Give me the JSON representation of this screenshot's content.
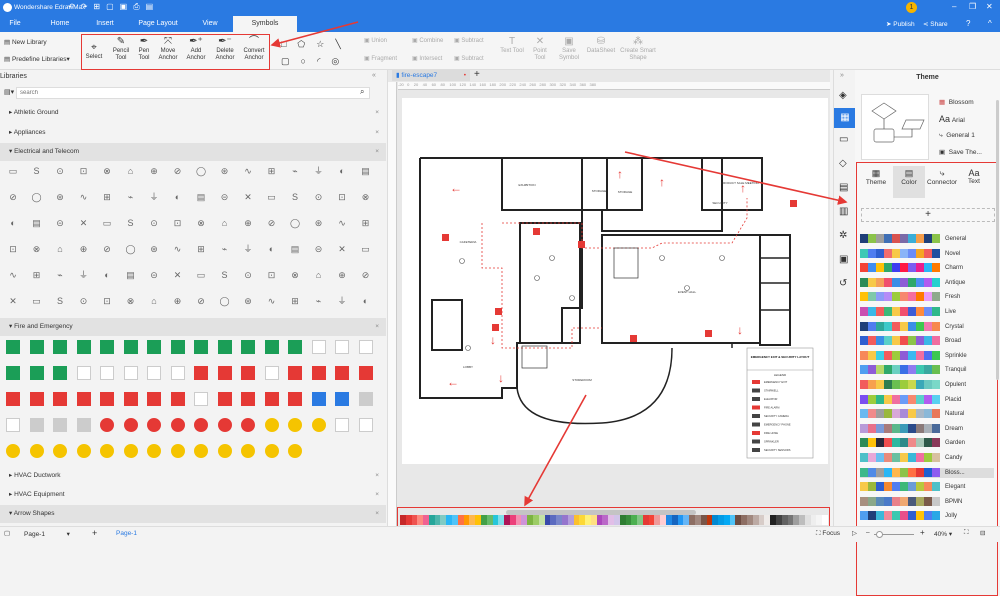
{
  "app": {
    "title": "Wondershare EdrawMax",
    "user_badge": "1",
    "publish": "Publish",
    "share": "Share"
  },
  "tabs": [
    "File",
    "Home",
    "Insert",
    "Page Layout",
    "View",
    "Symbols"
  ],
  "toolbar": {
    "new_library": "New Library",
    "predefine": "Predefine Libraries",
    "tools": [
      "Select",
      "Pencil Tool",
      "Pen Tool",
      "Move Anchor",
      "Add Anchor",
      "Delete Anchor",
      "Convert Anchor"
    ],
    "shape_ops": [
      "Union",
      "Combine",
      "Subtract",
      "Fragment",
      "Intersect",
      "Subtract"
    ],
    "more": [
      "Text Tool",
      "Point Tool",
      "Save Symbol",
      "DataSheet",
      "Create Smart Shape"
    ]
  },
  "libraries": {
    "title": "Libraries",
    "search_placeholder": "search",
    "categories": [
      "Athletic Ground",
      "Appliances",
      "Electrical and Telecom",
      "Fire and Emergency",
      "HVAC Ductwork",
      "HVAC Equipment",
      "Arrow Shapes"
    ]
  },
  "document": {
    "tab": "fire-escape7",
    "rooms": [
      "EXHIBITION",
      "STORAGE",
      "STORAGE",
      "SECURITY",
      "PRODUCT SALE MEETING",
      "CAFETERIA",
      "EVENT HALL",
      "LOBBY",
      "STOREROOM"
    ],
    "legend_title": "EMERGENCY EXIT & SECURITY LAYOUT",
    "legend_heading": "LEGEND",
    "legend_items": [
      "EMERGENCY EXIT",
      "STAIRWELL",
      "ELEVATOR",
      "FIRE ALARM",
      "SECURITY CAMERA",
      "EMERGENCY PHONE",
      "FIRE HOSE",
      "SPRINKLER",
      "SECURITY SENSORS"
    ]
  },
  "theme_panel": {
    "title": "Theme",
    "current": [
      "Blossom",
      "Arial",
      "General 1",
      "Save The..."
    ],
    "tabs": [
      "Theme",
      "Color",
      "Connector",
      "Text"
    ],
    "palettes": [
      {
        "name": "General",
        "colors": [
          "#1f3f78",
          "#8bc34a",
          "#9e9e9e",
          "#3f6fb5",
          "#d9534f",
          "#7a6aa8",
          "#3aaed8",
          "#f59d4a",
          "#1f3f78",
          "#8bc34a"
        ]
      },
      {
        "name": "Novel",
        "colors": [
          "#3ec9b5",
          "#4f7df0",
          "#2f5fd0",
          "#f06e6e",
          "#f7c948",
          "#8ab4f8",
          "#6a8cf7",
          "#f5a623",
          "#f25c5c",
          "#1e4fa0"
        ]
      },
      {
        "name": "Charm",
        "colors": [
          "#f44336",
          "#3f8ef0",
          "#ffc107",
          "#2ea86b",
          "#3d3df0",
          "#ff1744",
          "#7b5cf0",
          "#e91e8c",
          "#29b6f6",
          "#ff7a00"
        ]
      },
      {
        "name": "Antique",
        "colors": [
          "#2e8b57",
          "#f7c948",
          "#f5a05a",
          "#f0506e",
          "#3a8ee6",
          "#8e5cd6",
          "#2ea86b",
          "#4b8ff2",
          "#b05cf0",
          "#26d0ce"
        ]
      },
      {
        "name": "Fresh",
        "colors": [
          "#ffc107",
          "#7fc8a9",
          "#8c9cf7",
          "#b58cf7",
          "#9ccc3c",
          "#f7886e",
          "#f56ea0",
          "#ff7a00",
          "#e99cf7",
          "#8faa8c"
        ]
      },
      {
        "name": "Live",
        "colors": [
          "#c94fb0",
          "#3ab8e6",
          "#f25c5c",
          "#3cb878",
          "#f7c948",
          "#f04e6e",
          "#3d5cd6",
          "#ff8a3d",
          "#6a8cf7",
          "#2eb88a"
        ]
      },
      {
        "name": "Crystal",
        "colors": [
          "#1f3f78",
          "#4f7df0",
          "#2ea89b",
          "#3ec9c9",
          "#f25c5c",
          "#f7c948",
          "#3a8ee6",
          "#3cc850",
          "#f07ab0",
          "#f7884e"
        ]
      },
      {
        "name": "Broad",
        "colors": [
          "#2f5fd0",
          "#f25c5c",
          "#3a8ee6",
          "#5ad0c9",
          "#f7c948",
          "#f04e4e",
          "#8bc34a",
          "#8e5cd6",
          "#3ab8e6",
          "#f06ea0"
        ]
      },
      {
        "name": "Sprinkle",
        "colors": [
          "#f7885a",
          "#f7c948",
          "#3ad0e6",
          "#f25c5c",
          "#9ccc3c",
          "#8e5cd6",
          "#3ab8f0",
          "#f06ea0",
          "#4f6df0",
          "#3cc850"
        ]
      },
      {
        "name": "Tranquil",
        "colors": [
          "#4f9ef0",
          "#8e5cd6",
          "#b5d86a",
          "#2ea86b",
          "#6ad0c0",
          "#3a6fe6",
          "#8e7cf0",
          "#3cc8b0",
          "#3aa8a0",
          "#6abf50"
        ]
      },
      {
        "name": "Opulent",
        "colors": [
          "#f25c5c",
          "#f7a04e",
          "#f7c948",
          "#2e7d4f",
          "#6abf50",
          "#9ccc3c",
          "#c8d84e",
          "#3aa8b8",
          "#6ac8c0",
          "#7ad8c8"
        ]
      },
      {
        "name": "Placid",
        "colors": [
          "#7b4ff0",
          "#9ccc3c",
          "#2eb88a",
          "#f7c948",
          "#f06ea0",
          "#6a9cf7",
          "#f7886e",
          "#5ad0c9",
          "#b05cf0",
          "#5ad0f0"
        ]
      },
      {
        "name": "Natural",
        "colors": [
          "#6ab8f0",
          "#f08a8a",
          "#9e9e9e",
          "#9ab83c",
          "#d8a8d8",
          "#a88ad8",
          "#f7c948",
          "#a8b8c8",
          "#8ab8d8",
          "#e8785a"
        ]
      },
      {
        "name": "Dream",
        "colors": [
          "#b89ad8",
          "#e8708a",
          "#7a9ad8",
          "#a87a7a",
          "#5ab88a",
          "#3a9ab8",
          "#2a4a8a",
          "#8a7a7a",
          "#a8b0b8",
          "#4a6a9a"
        ]
      },
      {
        "name": "Garden",
        "colors": [
          "#2e8b57",
          "#ffc107",
          "#2a2a3a",
          "#f04e4e",
          "#2eb8a0",
          "#2e8a8a",
          "#f08a8a",
          "#a8c8b8",
          "#2e5a4a",
          "#8a3a5a"
        ]
      },
      {
        "name": "Candy",
        "colors": [
          "#4ec0c8",
          "#e8a8d8",
          "#6ac0f0",
          "#e88a7a",
          "#6ac0a0",
          "#f7c948",
          "#3ab8d8",
          "#f06ea0",
          "#9ccc3c",
          "#d8c0a0"
        ]
      },
      {
        "name": "Bloss...",
        "colors": [
          "#3cb88a",
          "#4f8ae6",
          "#9e9e9e",
          "#29b6f6",
          "#ffb74d",
          "#8bc34a",
          "#ff7043",
          "#e53935",
          "#1e5fd0",
          "#8e5cf0"
        ]
      },
      {
        "name": "Elegant",
        "colors": [
          "#f7c948",
          "#9ab83c",
          "#2f5fd0",
          "#f7882e",
          "#4f7df0",
          "#3cb878",
          "#6a9cd8",
          "#b8c83c",
          "#f7885a",
          "#4ec0c8"
        ]
      },
      {
        "name": "BPMN",
        "colors": [
          "#a89080",
          "#8aa88a",
          "#5a8ab8",
          "#4a7ac8",
          "#e8808a",
          "#f0a870",
          "#4a5a7a",
          "#a8a860",
          "#7a5a4a",
          "#c8c8c8"
        ]
      },
      {
        "name": "Jolly",
        "colors": [
          "#4f9ef0",
          "#1f3f78",
          "#3ab8d8",
          "#f08a9a",
          "#3cc8b0",
          "#e84e8a",
          "#2f5fd0",
          "#ffc107",
          "#4f7df0",
          "#29a8e6"
        ]
      }
    ]
  },
  "colorbar": [
    "#c62828",
    "#e53935",
    "#ef5350",
    "#ff8a80",
    "#f06292",
    "#26a69a",
    "#4db6ac",
    "#80cbc4",
    "#29b6f6",
    "#4fc3f7",
    "#ff7043",
    "#ff9800",
    "#ffb74d",
    "#ffc107",
    "#43a047",
    "#66bb6a",
    "#26c6da",
    "#80deea",
    "#ad1457",
    "#ec407a",
    "#f48fb1",
    "#ce93d8",
    "#7cb342",
    "#9ccc65",
    "#c5e1a5",
    "#3949ab",
    "#5c6bc0",
    "#7986cb",
    "#9575cd",
    "#b39ddb",
    "#fbc02d",
    "#fdd835",
    "#fff176",
    "#ffe082",
    "#ab47bc",
    "#ba68c8",
    "#e1bee7",
    "#d1c4e9",
    "#2e7d32",
    "#388e3c",
    "#4caf50",
    "#81c784",
    "#e53935",
    "#f44336",
    "#ef9a9a",
    "#ffcdd2",
    "#1e88e5",
    "#1565c0",
    "#2196f3",
    "#64b5f6",
    "#8d6e63",
    "#a1887f",
    "#795548",
    "#bf360c",
    "#0288d1",
    "#039be5",
    "#03a9f4",
    "#4fc3f7",
    "#6d4c41",
    "#8d6e63",
    "#a1887f",
    "#bcaaa4",
    "#d7ccc8",
    "#efebe9",
    "#212121",
    "#424242",
    "#616161",
    "#757575",
    "#9e9e9e",
    "#bdbdbd",
    "#e0e0e0",
    "#eeeeee",
    "#f5f5f5",
    "#ffffff"
  ],
  "status": {
    "page_select": "Page-1",
    "page_tab": "Page-1",
    "focus": "Focus",
    "zoom": "40%"
  }
}
